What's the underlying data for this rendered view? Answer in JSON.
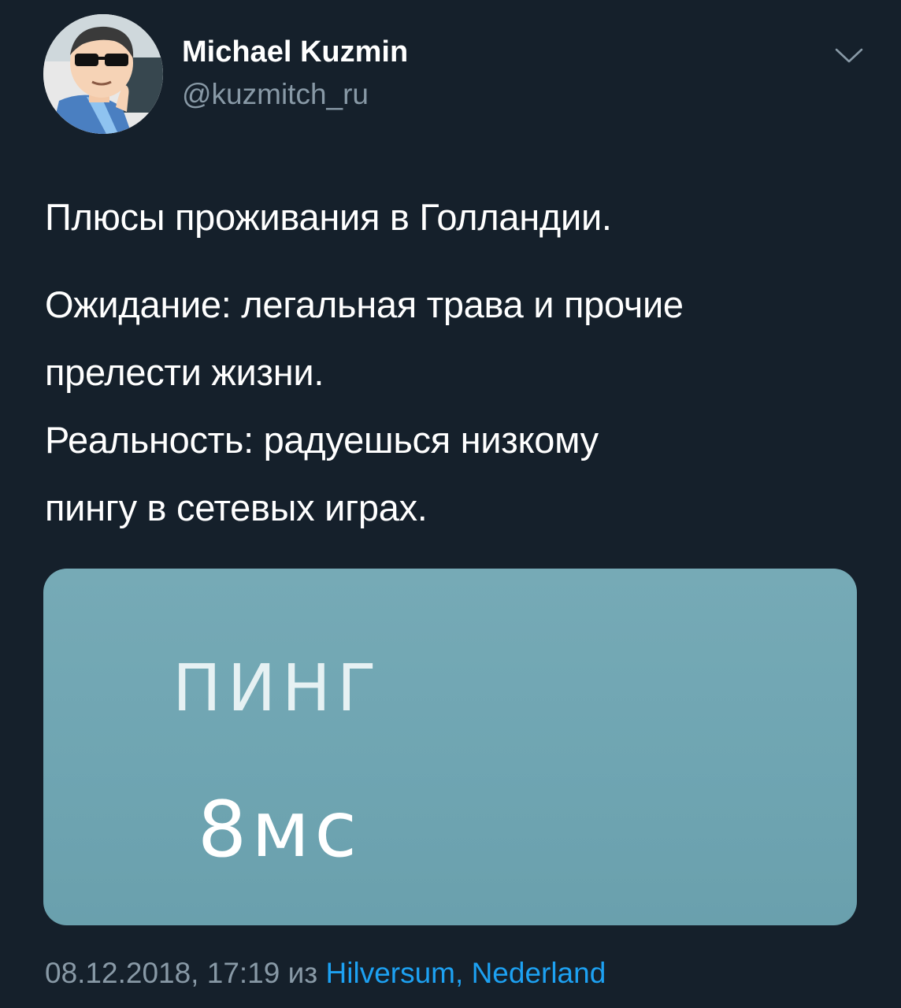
{
  "author": {
    "name": "Michael Kuzmin",
    "handle": "@kuzmitch_ru",
    "avatar_icon": "avatar-cartoon-sunglasses"
  },
  "menu": {
    "icon": "chevron-down-icon"
  },
  "tweet": {
    "line1": "Плюсы проживания в Голландии.",
    "line2": "Ожидание: легальная трава и прочие",
    "line3": "прелести жизни.",
    "line4": "Реальность: радуешься низкому",
    "line5": "пингу в сетевых играх."
  },
  "media": {
    "label": "ПИНГ",
    "value": "8мс",
    "background": "#6fa5b2"
  },
  "meta": {
    "timestamp": "08.12.2018, 17:19",
    "from": "из",
    "location": "Hilversum, Nederland"
  },
  "colors": {
    "background": "#15202b",
    "text": "#ffffff",
    "secondary": "#8899a6",
    "link": "#1da1f2"
  }
}
